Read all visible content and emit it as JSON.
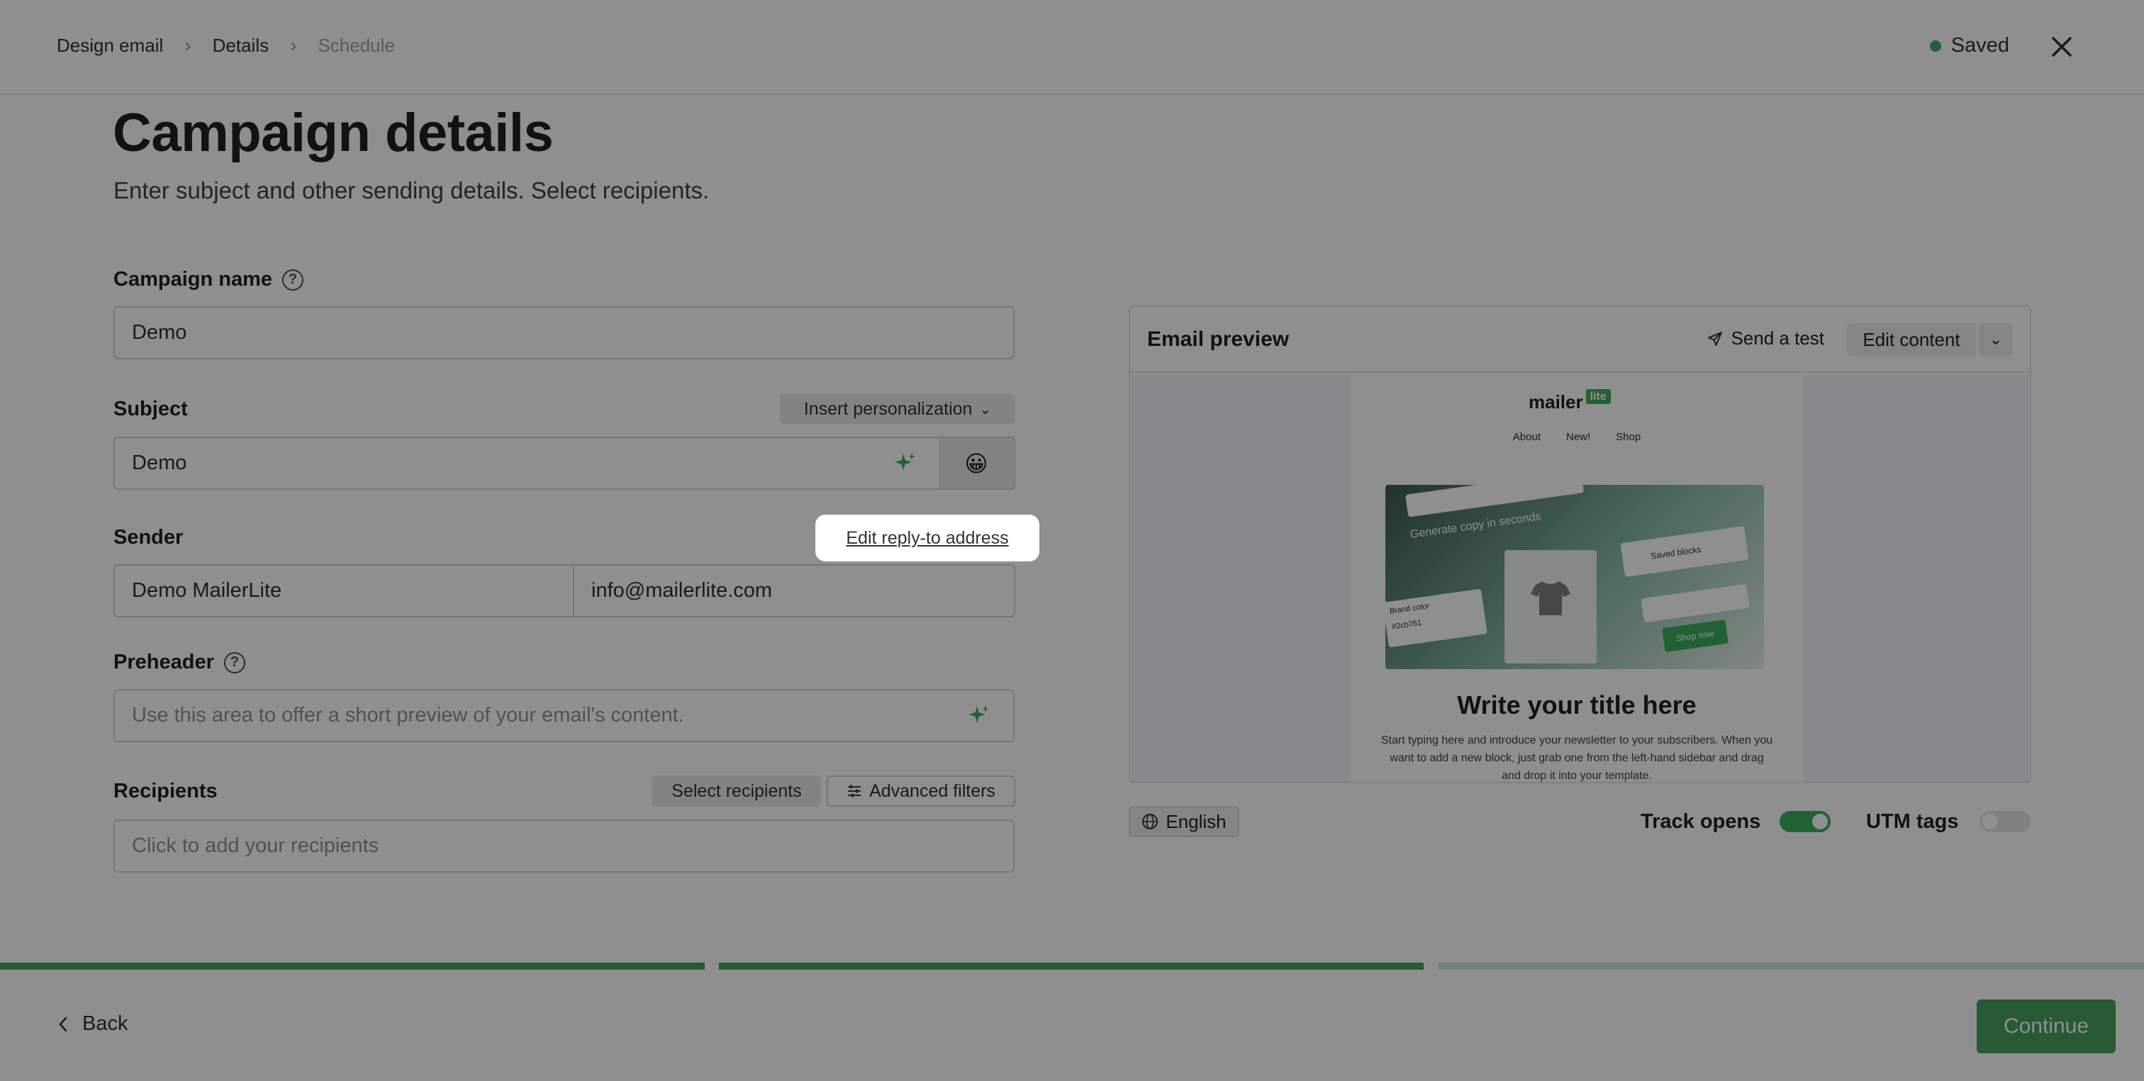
{
  "header": {
    "breadcrumbs": [
      "Design email",
      "Details",
      "Schedule"
    ],
    "saved_label": "Saved"
  },
  "main": {
    "title": "Campaign details",
    "subtitle": "Enter subject and other sending details. Select recipients."
  },
  "campaign_name": {
    "label": "Campaign name",
    "value": "Demo"
  },
  "subject": {
    "label": "Subject",
    "value": "Demo",
    "insert_personalization": "Insert personalization",
    "emoji": "😀"
  },
  "sender": {
    "label": "Sender",
    "name_value": "Demo MailerLite",
    "email_value": "info@mailerlite.com",
    "reply_to_link": "Edit reply-to address"
  },
  "preheader": {
    "label": "Preheader",
    "placeholder": "Use this area to offer a short preview of your email's content."
  },
  "recipients": {
    "label": "Recipients",
    "select_button": "Select recipients",
    "advanced_filters": "Advanced filters",
    "placeholder": "Click to add your recipients"
  },
  "preview": {
    "title": "Email preview",
    "send_test": "Send a test",
    "edit_content": "Edit content",
    "email": {
      "logo": "mailer",
      "logo_badge": "lite",
      "nav": [
        "About",
        "New!",
        "Shop"
      ],
      "heading": "Write your title here",
      "body": "Start typing here and introduce your newsletter to your subscribers. When you want to add a new block, just grab one from the left-hand sidebar and drag and drop it into your template.",
      "hero_caption": "Generate copy in seconds",
      "hero_saved_blocks": "Saved blocks",
      "hero_brand_color": "Brand color",
      "hero_brand_hex": "#2cb761",
      "hero_shop_now": "Shop now"
    },
    "language": "English",
    "track_opens": {
      "label": "Track opens",
      "enabled": true
    },
    "utm_tags": {
      "label": "UTM tags",
      "enabled": false
    }
  },
  "progress": {
    "steps_completed": 2,
    "steps_total": 3
  },
  "footer": {
    "back": "Back",
    "continue": "Continue"
  },
  "colors": {
    "accent_green": "#3a9a55",
    "saved_dot": "#2fa84f"
  }
}
